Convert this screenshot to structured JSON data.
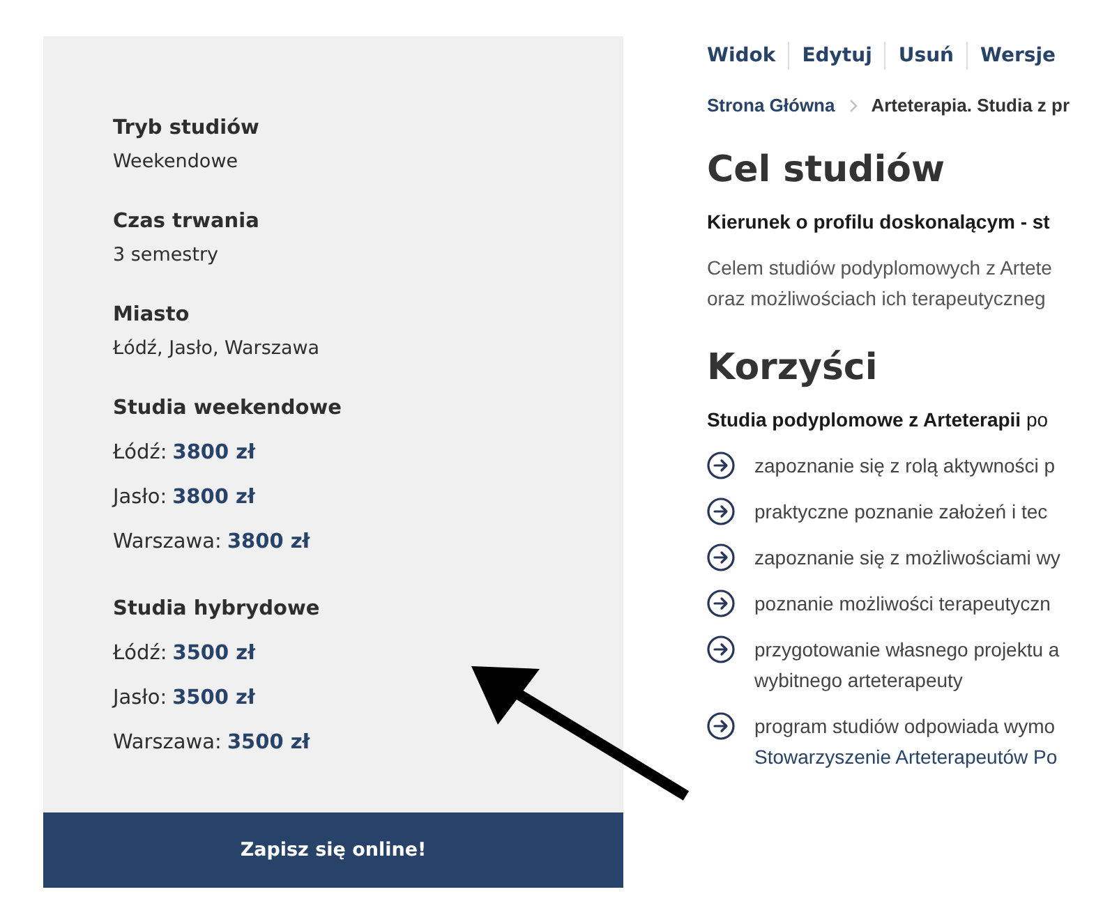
{
  "sidebar": {
    "facts": [
      {
        "label": "Tryb studiów",
        "value": "Weekendowe"
      },
      {
        "label": "Czas trwania",
        "value": "3 semestry"
      },
      {
        "label": "Miasto",
        "value": "Łódź, Jasło, Warszawa"
      }
    ],
    "price_groups": [
      {
        "title": "Studia weekendowe",
        "prices": [
          {
            "city": "Łódź:",
            "price": "3800 zł"
          },
          {
            "city": "Jasło:",
            "price": "3800 zł"
          },
          {
            "city": "Warszawa:",
            "price": "3800 zł"
          }
        ]
      },
      {
        "title": "Studia hybrydowe",
        "prices": [
          {
            "city": "Łódź:",
            "price": "3500 zł"
          },
          {
            "city": "Jasło:",
            "price": "3500 zł"
          },
          {
            "city": "Warszawa:",
            "price": "3500 zł"
          }
        ]
      }
    ],
    "signup_button": "Zapisz się online!"
  },
  "admin_tabs": [
    "Widok",
    "Edytuj",
    "Usuń",
    "Wersje"
  ],
  "breadcrumb": [
    "Strona Główna",
    "Arteterapia. Studia z pr"
  ],
  "sections": [
    {
      "heading": "Cel studiów",
      "lead": "Kierunek o profilu doskonalącym - st",
      "body_lines": [
        "Celem studiów podyplomowych z Artete",
        "oraz możliwościach ich terapeutyczneg"
      ]
    },
    {
      "heading": "Korzyści",
      "lead": "**Studia podyplomowe z Arteterapii** po",
      "items": [
        {
          "lines": [
            "zapoznanie się z rolą aktywności p"
          ]
        },
        {
          "lines": [
            "praktyczne poznanie założeń i tec"
          ]
        },
        {
          "lines": [
            "zapoznanie się z możliwościami wy"
          ]
        },
        {
          "lines": [
            "poznanie możliwości terapeutyczn"
          ]
        },
        {
          "lines": [
            "przygotowanie własnego projektu a",
            "wybitnego arteterapeuty"
          ]
        },
        {
          "lines": [
            "program studiów odpowiada wymo"
          ],
          "link": "Stowarzyszenie Arteterapeutów Po"
        }
      ]
    }
  ]
}
